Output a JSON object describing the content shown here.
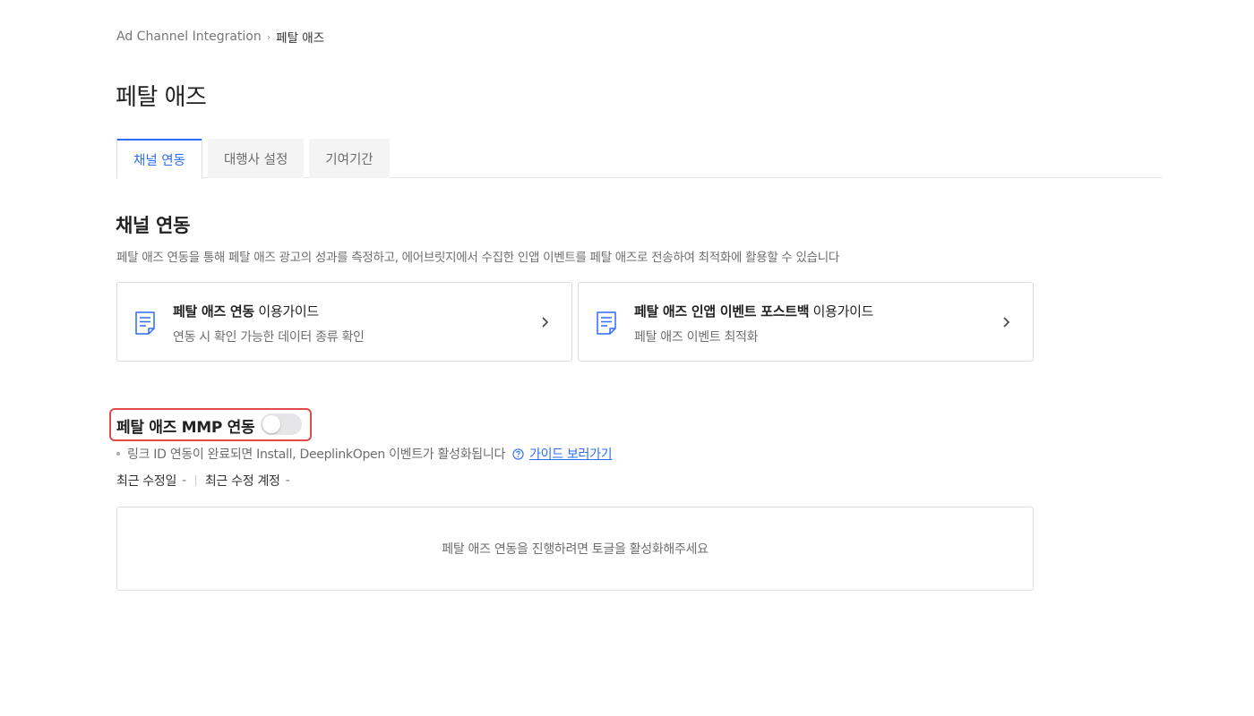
{
  "breadcrumb": {
    "root": "Ad Channel Integration",
    "current": "페탈 애즈"
  },
  "page_title": "페탈 애즈",
  "tabs": [
    {
      "label": "채널 연동",
      "active": true
    },
    {
      "label": "대행사 설정",
      "active": false
    },
    {
      "label": "기여기간",
      "active": false
    }
  ],
  "section": {
    "title": "채널 연동",
    "description": "페탈 애즈 연동을 통해 페탈 애즈 광고의 성과를 측정하고, 에어브릿지에서 수집한 인앱 이벤트를 페탈 애즈로 전송하여 최적화에 활용할 수 있습니다"
  },
  "guides": [
    {
      "title_bold": "페탈 애즈 연동",
      "title_rest": " 이용가이드",
      "subtitle": "연동 시 확인 가능한 데이터 종류 확인",
      "icon": "document-icon"
    },
    {
      "title_bold": "페탈 애즈 인앱 이벤트 포스트백",
      "title_rest": " 이용가이드",
      "subtitle": "페탈 애즈 이벤트 최적화",
      "icon": "document-icon"
    }
  ],
  "mmp": {
    "label": "페탈 애즈 MMP 연동",
    "toggle_on": false,
    "highlight_color": "#e04a4a",
    "note": "링크 ID 연동이 완료되면 Install, DeeplinkOpen 이벤트가 활성화됩니다",
    "guide_link": "가이드 보러가기",
    "last_modified_label": "최근 수정일",
    "last_modified_value": "-",
    "last_account_label": "최근 수정 계정",
    "last_account_value": "-",
    "empty_message": "페탈 애즈 연동을 진행하려면 토글을 활성화해주세요"
  },
  "colors": {
    "accent": "#2d6df6",
    "text": "#222222",
    "muted": "#6e6e6e"
  }
}
